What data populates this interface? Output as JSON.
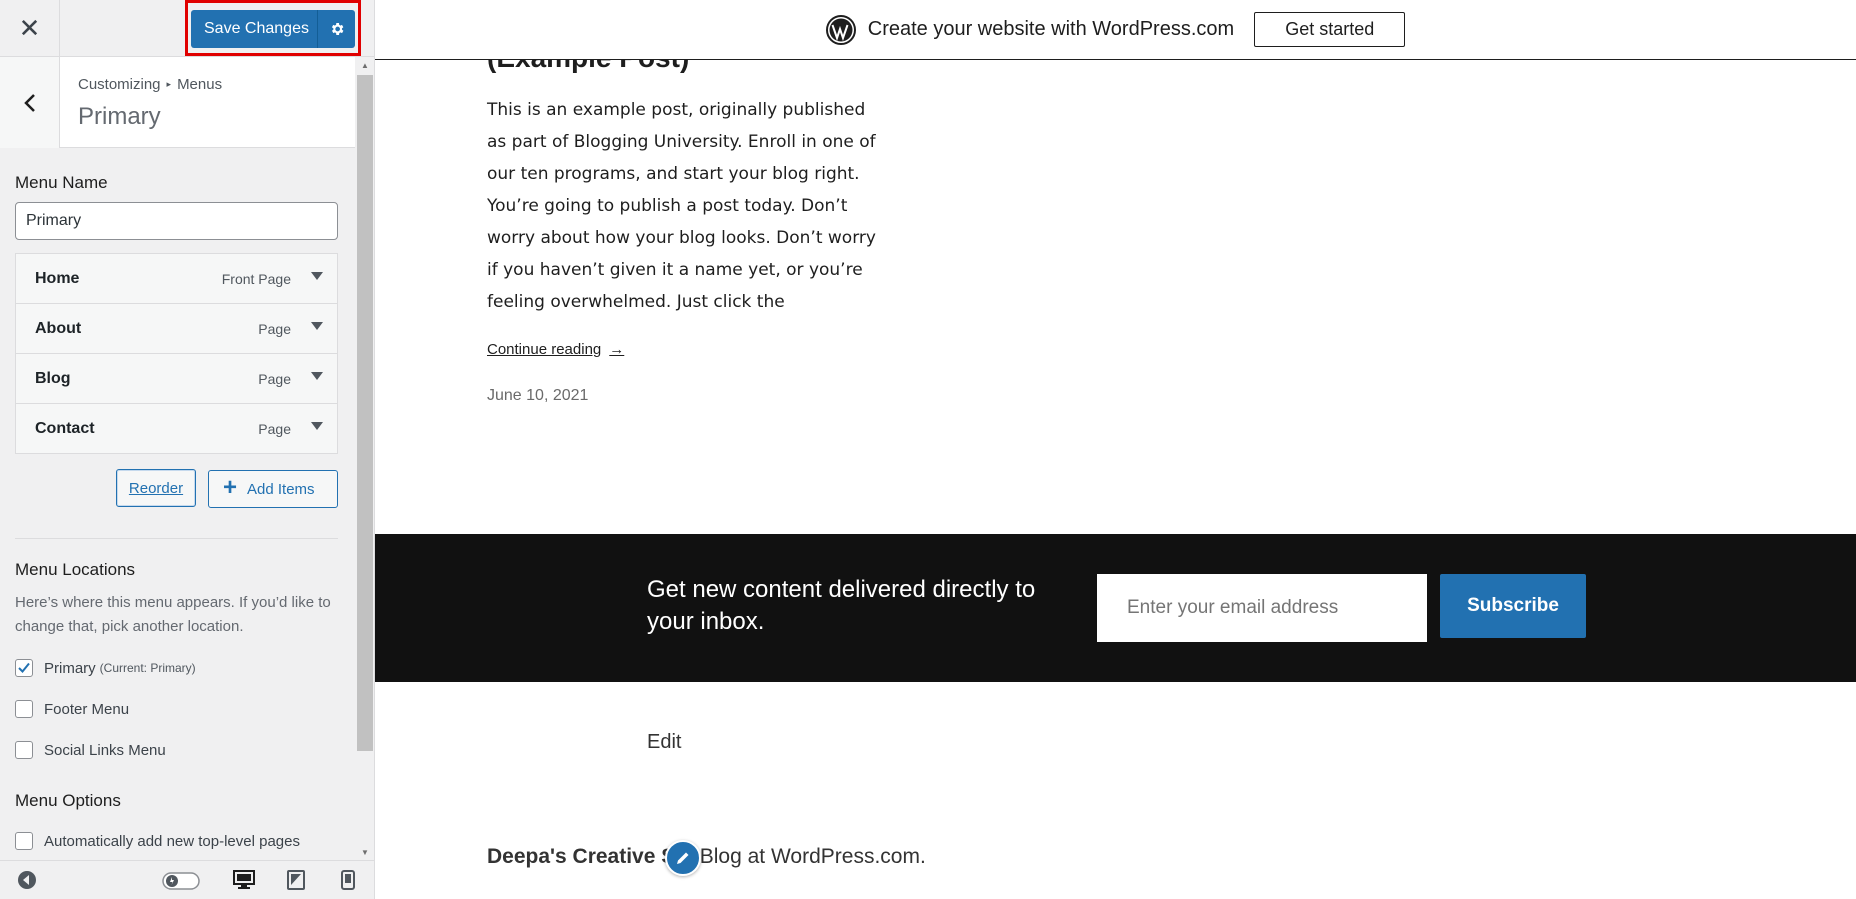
{
  "sidebar": {
    "close_icon": "close-icon",
    "save_label": "Save Changes",
    "breadcrumb": {
      "part1": "Customizing",
      "separator": "▸",
      "part2": "Menus"
    },
    "section_title": "Primary",
    "menu_name_label": "Menu Name",
    "menu_name_value": "Primary",
    "menu_items": [
      {
        "title": "Home",
        "type": "Front Page"
      },
      {
        "title": "About",
        "type": "Page"
      },
      {
        "title": "Blog",
        "type": "Page"
      },
      {
        "title": "Contact",
        "type": "Page"
      }
    ],
    "reorder_label": "Reorder",
    "add_items_label": "Add Items",
    "locations_heading": "Menu Locations",
    "locations_desc": "Here’s where this menu appears. If you’d like to change that, pick another location.",
    "locations": [
      {
        "label": "Primary",
        "note": "(Current: Primary)",
        "checked": true
      },
      {
        "label": "Footer Menu",
        "note": "",
        "checked": false
      },
      {
        "label": "Social Links Menu",
        "note": "",
        "checked": false
      }
    ],
    "options_heading": "Menu Options",
    "auto_add_label": "Automatically add new top-level pages"
  },
  "preview": {
    "wpcom_text": "Create your website with WordPress.com",
    "get_started_label": "Get started",
    "post_title": "(Example Post)",
    "post_body": "This is an example post, originally published as part of Blogging University. Enroll in one of our ten programs, and start your blog right. You’re going to publish a post today. Don’t worry about how your blog looks. Don’t worry if you haven’t given it a name yet, or you’re feeling overwhelmed. Just click the",
    "continue_label": "Continue reading",
    "continue_arrow": "→",
    "post_date": "June 10, 2021",
    "subscribe_text": "Get new content delivered directly to your inbox.",
    "email_placeholder": "Enter your email address",
    "subscribe_label": "Subscribe",
    "edit_label": "Edit",
    "site_name": "Deepa's Creative Sp",
    "footer_suffix": ", Blog at WordPress.com."
  },
  "colors": {
    "accent": "#2271b1",
    "highlight": "#e00000",
    "band": "#111111"
  }
}
